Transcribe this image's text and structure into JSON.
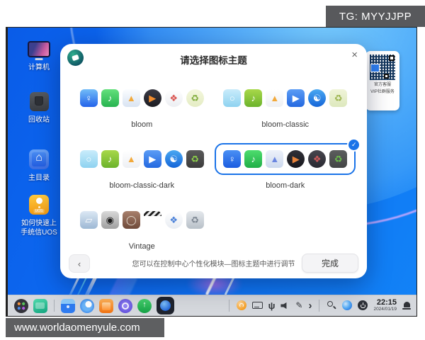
{
  "watermark_top": {
    "text": "TG: MYYJJPP"
  },
  "watermark_bottom": {
    "text": "www.worldaomenyule.com"
  },
  "desktop": {
    "icons": [
      {
        "name": "computer",
        "label": "计算机"
      },
      {
        "name": "recycle-bin",
        "label": "回收站"
      },
      {
        "name": "home",
        "label": "主目录"
      },
      {
        "name": "uos-guide",
        "label": "如何快速上手统信UOS",
        "badge": "UOS"
      }
    ],
    "qr_panel": {
      "caption_lines": [
        "官方客服",
        "VIP社群服务"
      ]
    }
  },
  "dialog": {
    "title": "请选择图标主题",
    "close_label": "×",
    "selected_check": "✓",
    "themes": [
      {
        "label": "bloom",
        "selected": false,
        "icons": [
          {
            "name": "file-manager",
            "glyph": "♀",
            "shape": "sq",
            "c1": "#72bcf8",
            "c2": "#2363ea",
            "fg": "#ffffff"
          },
          {
            "name": "music",
            "glyph": "♪",
            "shape": "sq",
            "c1": "#63e07c",
            "c2": "#27b350",
            "fg": "#ffffff"
          },
          {
            "name": "photos",
            "glyph": "▲",
            "shape": "sq",
            "c1": "#fbfdff",
            "c2": "#d9e4f2",
            "fg": "#f2a93b"
          },
          {
            "name": "video",
            "glyph": "▶",
            "shape": "ci",
            "c1": "#3a3a44",
            "c2": "#1c1c22",
            "fg": "#f08c2e"
          },
          {
            "name": "app-store",
            "glyph": "❖",
            "shape": "ci",
            "c1": "#ffffff",
            "c2": "#eceef2",
            "fg": "#d9534f"
          },
          {
            "name": "trash",
            "glyph": "♻",
            "shape": "ci",
            "c1": "#f4f7dd",
            "c2": "#e4ecc4",
            "fg": "#7fab3a"
          }
        ]
      },
      {
        "label": "bloom-classic",
        "selected": false,
        "icons": [
          {
            "name": "file-manager-classic",
            "glyph": "○",
            "shape": "sq",
            "c1": "#c9ecfb",
            "c2": "#8ed2f0",
            "fg": "#ffffff"
          },
          {
            "name": "music-vinyl",
            "glyph": "♪",
            "shape": "sq",
            "c1": "#a8d84a",
            "c2": "#6cb32c",
            "fg": "#ffffff"
          },
          {
            "name": "photos-classic",
            "glyph": "▲",
            "shape": "sq",
            "c1": "#ffffff",
            "c2": "#eef0f4",
            "fg": "#f2a93b"
          },
          {
            "name": "video-classic",
            "glyph": "▶",
            "shape": "sq",
            "c1": "#5b9cf5",
            "c2": "#2469e0",
            "fg": "#ffffff"
          },
          {
            "name": "browser",
            "glyph": "☯",
            "shape": "ci",
            "c1": "#4aa8f2",
            "c2": "#1565d8",
            "fg": "#ffffff"
          },
          {
            "name": "trash-basket",
            "glyph": "♻",
            "shape": "sq",
            "c1": "#f0f4d8",
            "c2": "#dde8bd",
            "fg": "#9ab24a"
          }
        ]
      },
      {
        "label": "bloom-classic-dark",
        "selected": false,
        "icons": [
          {
            "name": "file-manager-classic",
            "glyph": "○",
            "shape": "sq",
            "c1": "#c9ecfb",
            "c2": "#8ed2f0",
            "fg": "#ffffff"
          },
          {
            "name": "music-vinyl",
            "glyph": "♪",
            "shape": "sq",
            "c1": "#a8d84a",
            "c2": "#6cb32c",
            "fg": "#ffffff"
          },
          {
            "name": "photos-classic",
            "glyph": "▲",
            "shape": "sq",
            "c1": "#ffffff",
            "c2": "#eef0f4",
            "fg": "#f2a93b"
          },
          {
            "name": "video-classic",
            "glyph": "▶",
            "shape": "sq",
            "c1": "#5b9cf5",
            "c2": "#2469e0",
            "fg": "#ffffff"
          },
          {
            "name": "browser",
            "glyph": "☯",
            "shape": "ci",
            "c1": "#4aa8f2",
            "c2": "#1565d8",
            "fg": "#ffffff"
          },
          {
            "name": "trash-dark-can",
            "glyph": "♻",
            "shape": "sq",
            "c1": "#5a5a5a",
            "c2": "#3c3c3c",
            "fg": "#8fd44a"
          }
        ]
      },
      {
        "label": "bloom-dark",
        "selected": true,
        "icons": [
          {
            "name": "file-manager-dark",
            "glyph": "♀",
            "shape": "sq",
            "c1": "#4a90f4",
            "c2": "#1b5ce0",
            "fg": "#ffffff"
          },
          {
            "name": "music-dark",
            "glyph": "♪",
            "shape": "sq",
            "c1": "#4edd6e",
            "c2": "#1fae47",
            "fg": "#ffffff"
          },
          {
            "name": "photos-dark",
            "glyph": "▲",
            "shape": "sq",
            "c1": "#eef2fa",
            "c2": "#ccd9ee",
            "fg": "#6b86e0"
          },
          {
            "name": "video-dark",
            "glyph": "▶",
            "shape": "ci",
            "c1": "#303038",
            "c2": "#18181e",
            "fg": "#e8833a"
          },
          {
            "name": "app-store-dark",
            "glyph": "❖",
            "shape": "ci",
            "c1": "#46464e",
            "c2": "#2a2a32",
            "fg": "#cf5b5b"
          },
          {
            "name": "trash-dark",
            "glyph": "♻",
            "shape": "sq",
            "c1": "#5c5e5e",
            "c2": "#434545",
            "fg": "#6cc04a"
          }
        ]
      },
      {
        "label": "Vintage",
        "selected": false,
        "icons": [
          {
            "name": "folder-vintage",
            "glyph": "▱",
            "shape": "sq",
            "c1": "#dce8f4",
            "c2": "#9db8d4",
            "fg": "#ffffff"
          },
          {
            "name": "record-player",
            "glyph": "◉",
            "shape": "sq",
            "c1": "#d8d8d8",
            "c2": "#a0a0a0",
            "fg": "#1c1c1c"
          },
          {
            "name": "photo-viewer-vintage",
            "glyph": "◯",
            "shape": "sq",
            "c1": "#a8806c",
            "c2": "#6e4a3a",
            "fg": "#e8e0d4"
          },
          {
            "name": "clapperboard",
            "glyph": "▶",
            "shape": "sq",
            "c1": "#3a3a3a",
            "c2": "#1e1e1e",
            "fg": "#ffffff"
          },
          {
            "name": "dots-app",
            "glyph": "❖",
            "shape": "ci",
            "c1": "#ffffff",
            "c2": "#e8ecf2",
            "fg": "#4a80d8"
          },
          {
            "name": "trash-metal",
            "glyph": "♻",
            "shape": "sq",
            "c1": "#e4e8ec",
            "c2": "#b8c0c8",
            "fg": "#7a8490"
          }
        ]
      }
    ],
    "footer": {
      "back_label": "‹",
      "hint": "您可以在控制中心个性化模块—图标主题中进行调节",
      "done_label": "完成"
    }
  },
  "taskbar": {
    "left_icons": [
      "launcher",
      "terminal",
      "separator",
      "file-manager",
      "browser",
      "app-store",
      "control-center",
      "software-center"
    ],
    "active_icon": "theme-switcher",
    "right_icons": [
      "separator",
      "update",
      "keyboard",
      "usb",
      "volume",
      "pen",
      "chevron",
      "separator",
      "search",
      "network",
      "power"
    ],
    "clock": {
      "time": "22:15",
      "date": "2024/01/19"
    }
  },
  "colors": {
    "selection_accent": "#1a73e8",
    "wallpaper_blue": "#0d6cf2",
    "taskbar_gray": "#d5d8dd",
    "watermark_gray": "#58595c"
  }
}
